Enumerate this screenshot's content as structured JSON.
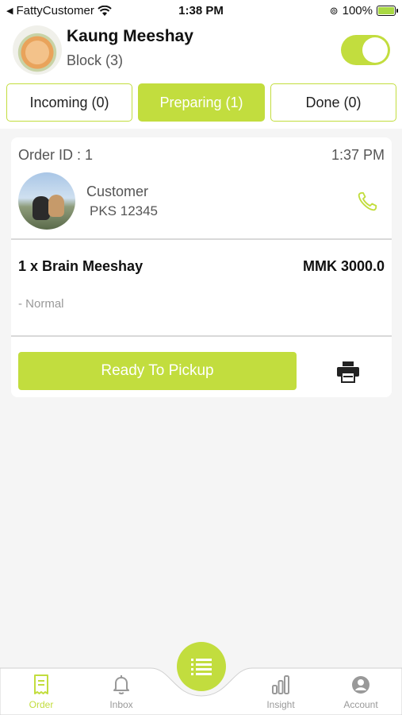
{
  "status_bar": {
    "back_app": "FattyCustomer",
    "time": "1:38 PM",
    "battery": "100%",
    "battery_level": 1.0
  },
  "header": {
    "store_name": "Kaung Meeshay",
    "store_sub": "Block (3)",
    "toggle_on": true
  },
  "tabs": [
    {
      "label": "Incoming (0)",
      "active": false
    },
    {
      "label": "Preparing (1)",
      "active": true
    },
    {
      "label": "Done (0)",
      "active": false
    }
  ],
  "order": {
    "id_label": "Order ID : 1",
    "time": "1:37 PM",
    "customer_label": "Customer",
    "customer_code": "PKS 12345",
    "item_name": "1 x Brain Meeshay",
    "item_price": "MMK 3000.0",
    "item_note": "- Normal",
    "ready_button": "Ready To Pickup"
  },
  "bottom_nav": {
    "items": [
      {
        "label": "Order",
        "icon": "receipt-icon",
        "active": true
      },
      {
        "label": "Inbox",
        "icon": "bell-icon",
        "active": false
      },
      {
        "label": "Insight",
        "icon": "bar-chart-icon",
        "active": false
      },
      {
        "label": "Account",
        "icon": "user-circle-icon",
        "active": false
      }
    ],
    "center_icon": "list-icon"
  },
  "colors": {
    "accent": "#c2dd3e",
    "text_dark": "#111111",
    "text_muted": "#999999",
    "background": "#f5f5f5"
  }
}
